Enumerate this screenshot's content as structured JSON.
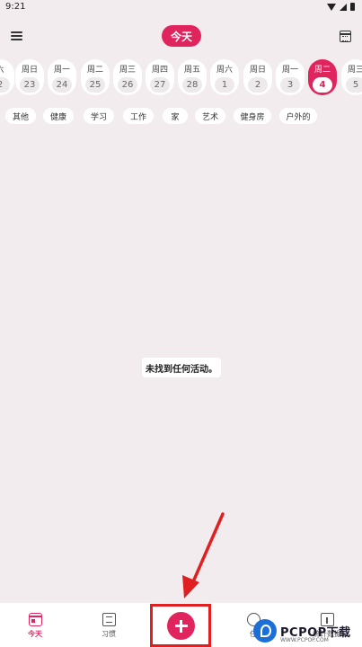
{
  "status_bar": {
    "time": "9:21"
  },
  "app_bar": {
    "today_label": "今天"
  },
  "dates": [
    {
      "weekday": "六",
      "day": "2"
    },
    {
      "weekday": "周日",
      "day": "23"
    },
    {
      "weekday": "周一",
      "day": "24"
    },
    {
      "weekday": "周二",
      "day": "25"
    },
    {
      "weekday": "周三",
      "day": "26"
    },
    {
      "weekday": "周四",
      "day": "27"
    },
    {
      "weekday": "周五",
      "day": "28"
    },
    {
      "weekday": "周六",
      "day": "1"
    },
    {
      "weekday": "周日",
      "day": "2"
    },
    {
      "weekday": "周一",
      "day": "3"
    },
    {
      "weekday": "周二",
      "day": "4"
    },
    {
      "weekday": "周三",
      "day": "5"
    }
  ],
  "categories": [
    "其他",
    "健康",
    "学习",
    "工作",
    "家",
    "艺术",
    "健身房",
    "户外的"
  ],
  "empty_state": {
    "message": "未找到任何活动。"
  },
  "bottom_nav": {
    "today": "今天",
    "habits": "习惯",
    "tasks": "任",
    "stats": "统计数据"
  },
  "watermark": {
    "brand": "PCPOP下载",
    "sub": "WWW.PCPOP.COM"
  },
  "colors": {
    "accent": "#e0245e",
    "background": "#f3ecef",
    "highlight": "#e02020",
    "watermark_blue": "#1d6fd8"
  }
}
